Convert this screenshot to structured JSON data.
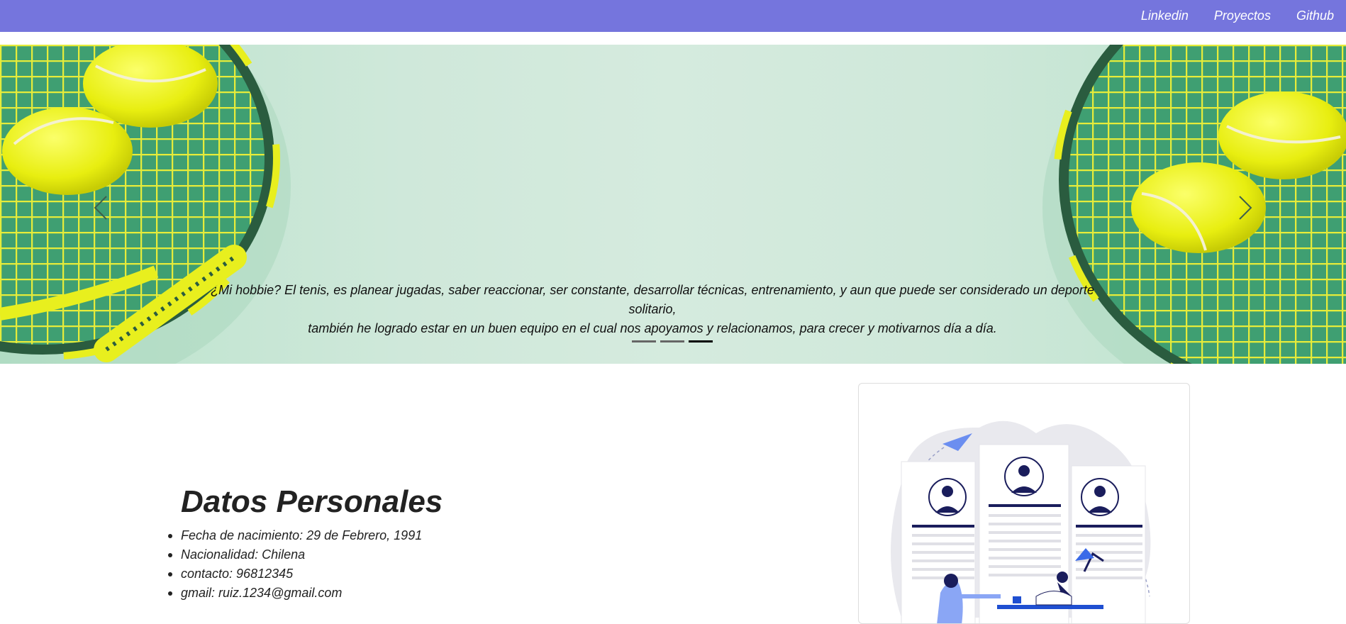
{
  "nav": {
    "links": [
      "Linkedin",
      "Proyectos",
      "Github"
    ]
  },
  "carousel": {
    "caption_line1": "¿Mi hobbie? El tenis, es planear jugadas, saber reaccionar, ser constante, desarrollar técnicas, entrenamiento, y aun que puede ser considerado un deporte solitario,",
    "caption_line2": "también he logrado estar en un buen equipo en el cual nos apoyamos y relacionamos, para crecer y motivarnos día a día.",
    "slide_count": 3,
    "active_slide": 3
  },
  "personal": {
    "title": "Datos Personales",
    "items": [
      "Fecha de nacimiento: 29 de Febrero, 1991",
      "Nacionalidad: Chilena",
      "contacto: 96812345",
      "gmail: ruiz.1234@gmail.com"
    ]
  },
  "colors": {
    "navbar": "#7575dd",
    "carousel_bg": "#cfe8da",
    "illustration_accent": "#1a1d5c"
  }
}
